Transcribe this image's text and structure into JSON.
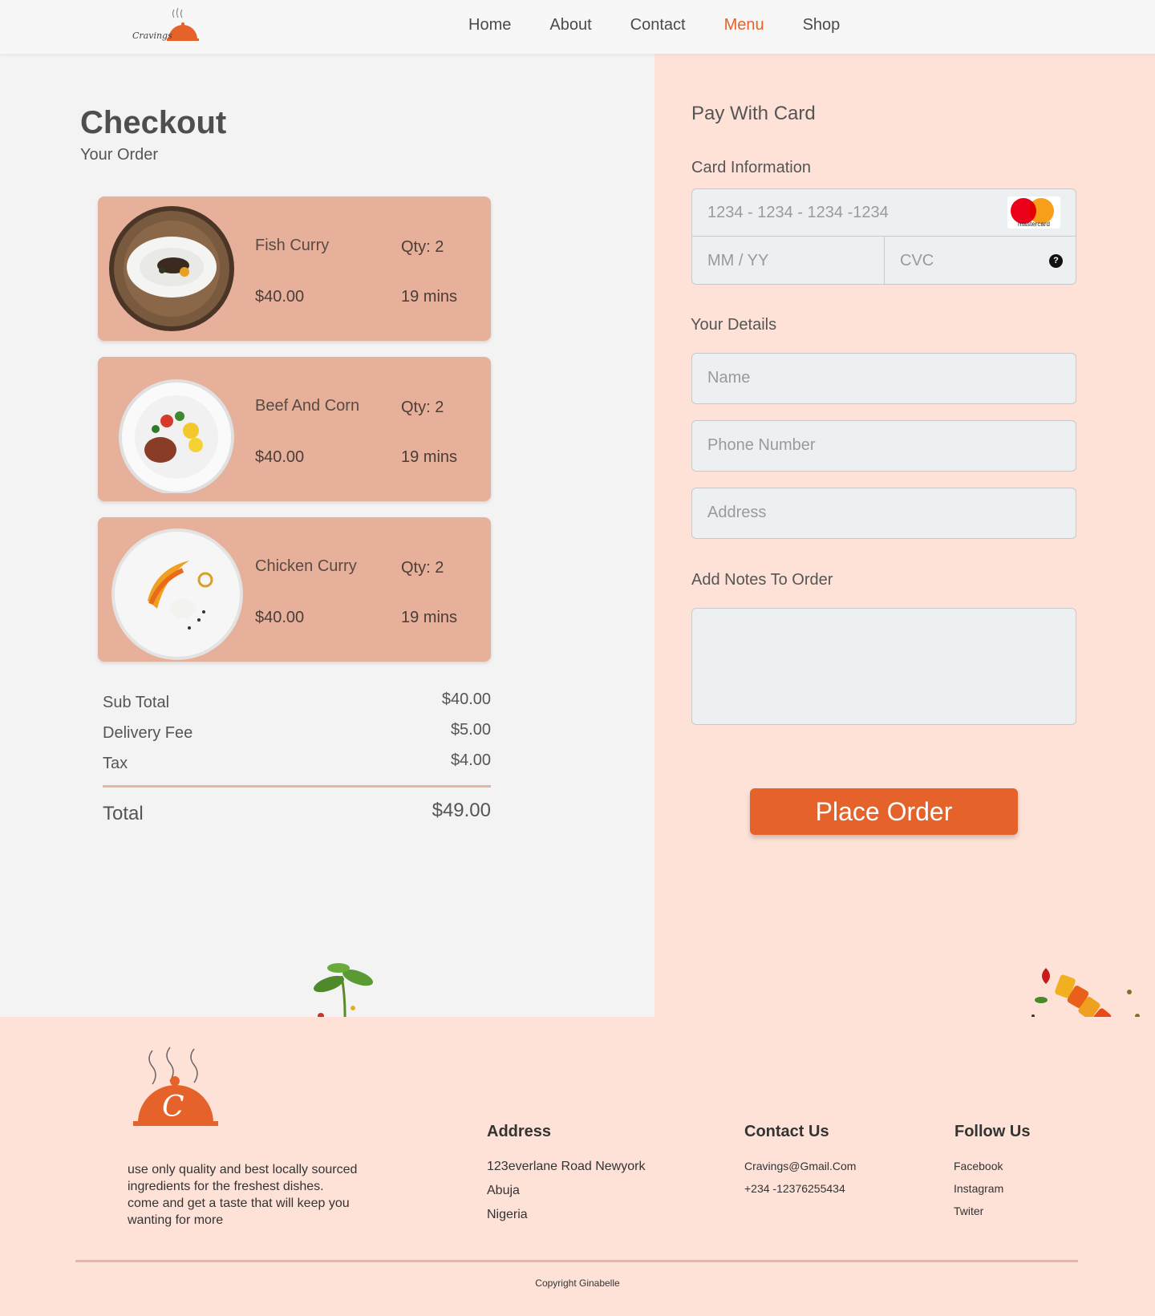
{
  "header": {
    "logo_text": "Cravings",
    "nav": [
      {
        "label": "Home"
      },
      {
        "label": "About"
      },
      {
        "label": "Contact"
      },
      {
        "label": "Menu"
      },
      {
        "label": "Shop"
      }
    ]
  },
  "checkout": {
    "title": "Checkout",
    "subtitle": "Your Order",
    "items": [
      {
        "name": "Fish Curry",
        "price": "$40.00",
        "qty": "Qty: 2",
        "time": "19 mins"
      },
      {
        "name": "Beef And Corn",
        "price": "$40.00",
        "qty": "Qty: 2",
        "time": "19 mins"
      },
      {
        "name": "Chicken Curry",
        "price": "$40.00",
        "qty": "Qty: 2",
        "time": "19 mins"
      }
    ],
    "summary": {
      "subtotal_label": "Sub Total",
      "subtotal": "$40.00",
      "delivery_label": "Delivery Fee",
      "delivery": "$5.00",
      "tax_label": "Tax",
      "tax": "$4.00",
      "total_label": "Total",
      "total": "$49.00"
    }
  },
  "payment": {
    "heading": "Pay With Card",
    "card_info_label": "Card Information",
    "card_number_placeholder": "1234 - 1234 - 1234 -1234",
    "card_brand": "mastercard",
    "expiry_placeholder": "MM / YY",
    "cvc_placeholder": "CVC",
    "details_label": "Your Details",
    "name_placeholder": "Name",
    "phone_placeholder": "Phone Number",
    "address_placeholder": "Address",
    "notes_label": "Add Notes To Order",
    "place_order_label": "Place Order"
  },
  "footer": {
    "tagline": "use only quality and best locally sourced ingredients for the freshest dishes.\ncome and get a taste that will keep you wanting for more",
    "address_heading": "Address",
    "address_lines": [
      "123everlane Road Newyork",
      "Abuja",
      "Nigeria"
    ],
    "contact_heading": "Contact Us",
    "contact_lines": [
      "Cravings@Gmail.Com",
      "+234 -12376255434"
    ],
    "follow_heading": "Follow Us",
    "follow_links": [
      "Facebook",
      "Instagram",
      "Twiter"
    ],
    "copyright": "Copyright Ginabelle"
  },
  "colors": {
    "accent": "#e5622a",
    "card_bg": "#e6b09b",
    "right_bg": "#fee2d8",
    "left_bg": "#f3f3f3"
  }
}
